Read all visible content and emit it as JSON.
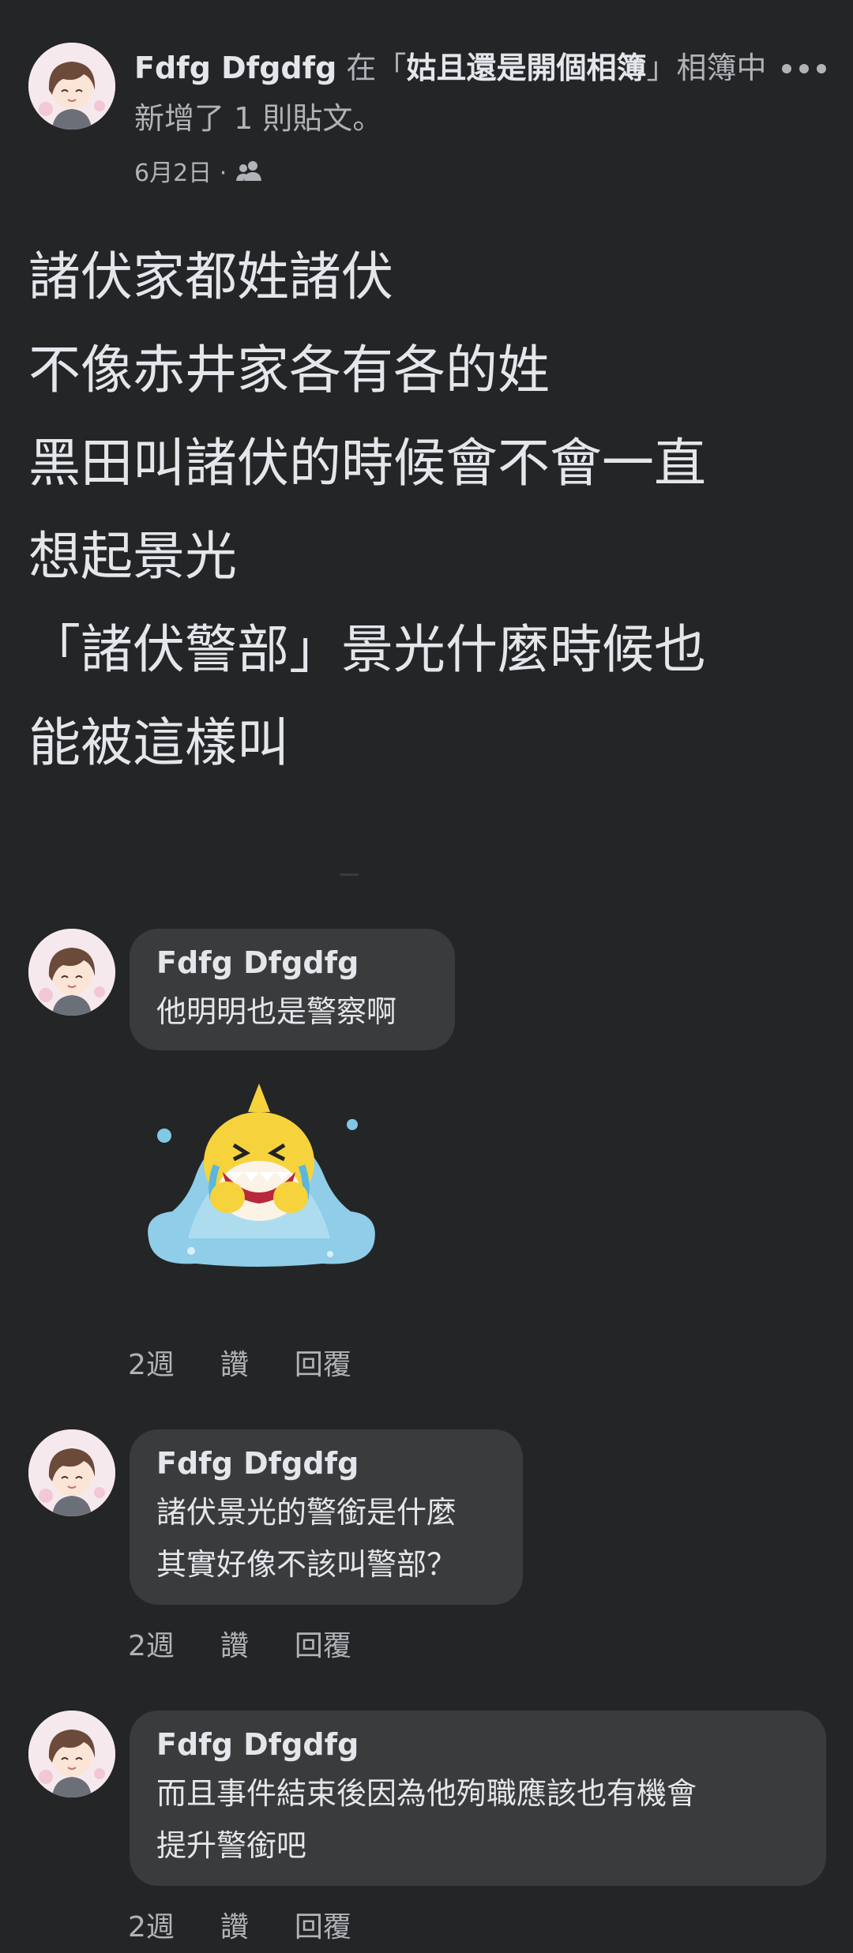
{
  "post": {
    "author": "Fdfg Dfgdfg",
    "action_prefix": " 在「",
    "album_name": "姑且還是開個相簿",
    "action_suffix": "」相簿中新增了 1 則貼文。",
    "date": "6月2日 ·",
    "privacy_icon": "friends-icon",
    "more_icon": "more-dots-icon",
    "body_lines": [
      "諸伏家都姓諸伏",
      "不像赤井家各有各的姓",
      "黑田叫諸伏的時候會不會一直",
      "想起景光",
      "「諸伏警部」景光什麼時候也",
      "能被這樣叫"
    ]
  },
  "comments": [
    {
      "author": "Fdfg Dfgdfg",
      "lines": [
        "他明明也是警察啊"
      ],
      "sticker": "crying-shark-sticker",
      "time": "2週",
      "like": "讚",
      "reply": "回覆"
    },
    {
      "author": "Fdfg Dfgdfg",
      "lines": [
        "諸伏景光的警銜是什麼",
        "其實好像不該叫警部？"
      ],
      "time": "2週",
      "like": "讚",
      "reply": "回覆"
    },
    {
      "author": "Fdfg Dfgdfg",
      "lines": [
        "而且事件結束後因為他殉職應該也有機會",
        "提升警銜吧"
      ],
      "time": "2週",
      "like": "讚",
      "reply": "回覆"
    }
  ],
  "colors": {
    "background": "#242526",
    "bubble": "#3a3b3c",
    "primary_text": "#e4e6eb",
    "secondary_text": "#b0b3b8"
  }
}
